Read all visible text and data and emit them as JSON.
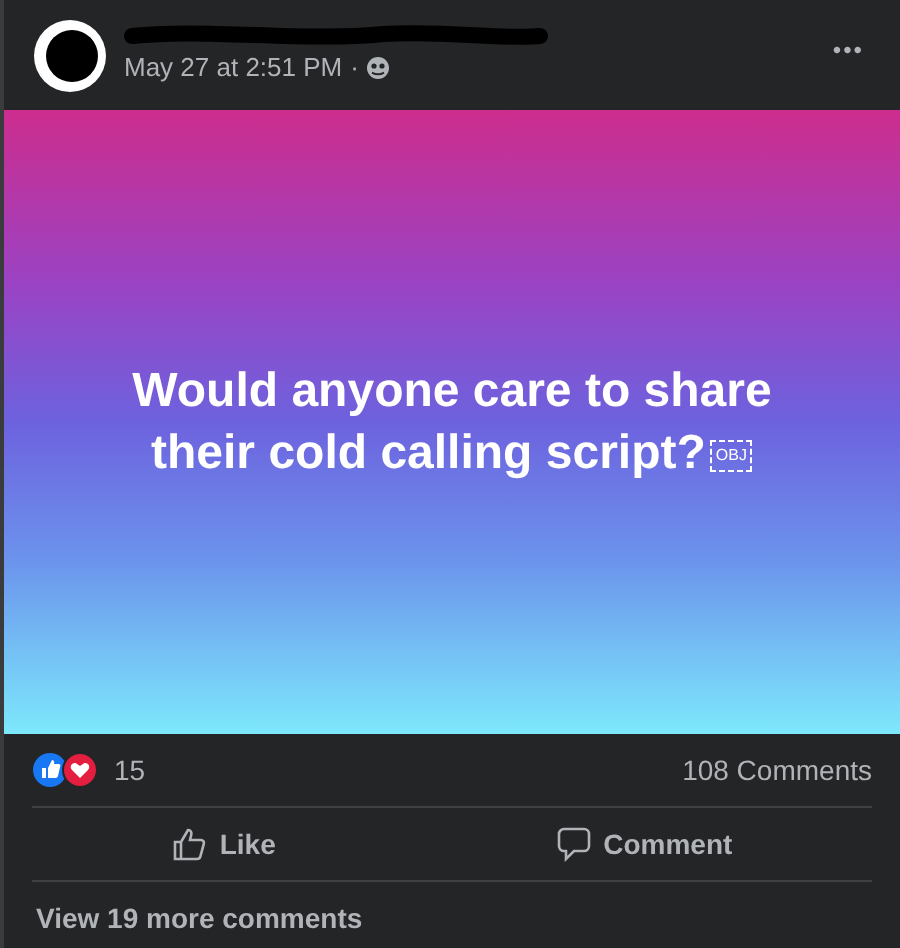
{
  "post": {
    "timestamp": "May 27 at 2:51 PM",
    "separator": "·",
    "menu": "•••",
    "banner_lines": [
      "Would anyone care to share",
      "their cold calling script?"
    ],
    "object_glyph": "OBJ",
    "reaction_count": "15",
    "comment_count": "108 Comments",
    "actions": [
      {
        "kind": "like",
        "label": "Like"
      },
      {
        "kind": "comment",
        "label": "Comment"
      }
    ],
    "more_comments": "View 19 more comments"
  }
}
